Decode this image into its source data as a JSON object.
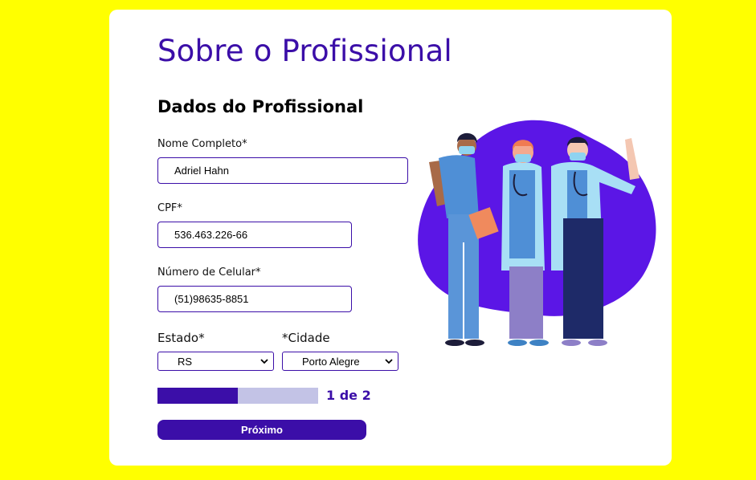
{
  "page": {
    "title": "Sobre o Profissional",
    "section_title": "Dados do Profissional"
  },
  "form": {
    "nome": {
      "label": "Nome Completo*",
      "value": "Adriel Hahn"
    },
    "cpf": {
      "label": "CPF*",
      "value": "536.463.226-66"
    },
    "celular": {
      "label": "Número de Celular*",
      "value": "(51)98635-8851"
    },
    "estado": {
      "label": "Estado*",
      "value": "RS"
    },
    "cidade": {
      "label": "*Cidade",
      "value": "Porto Alegre"
    }
  },
  "progress": {
    "text": "1 de 2",
    "fraction": 0.5
  },
  "actions": {
    "next_label": "Próximo"
  },
  "colors": {
    "background": "#ffff00",
    "accent": "#3b0ea8",
    "progress_track": "#c3c3e6",
    "blob": "#5b16e6"
  }
}
